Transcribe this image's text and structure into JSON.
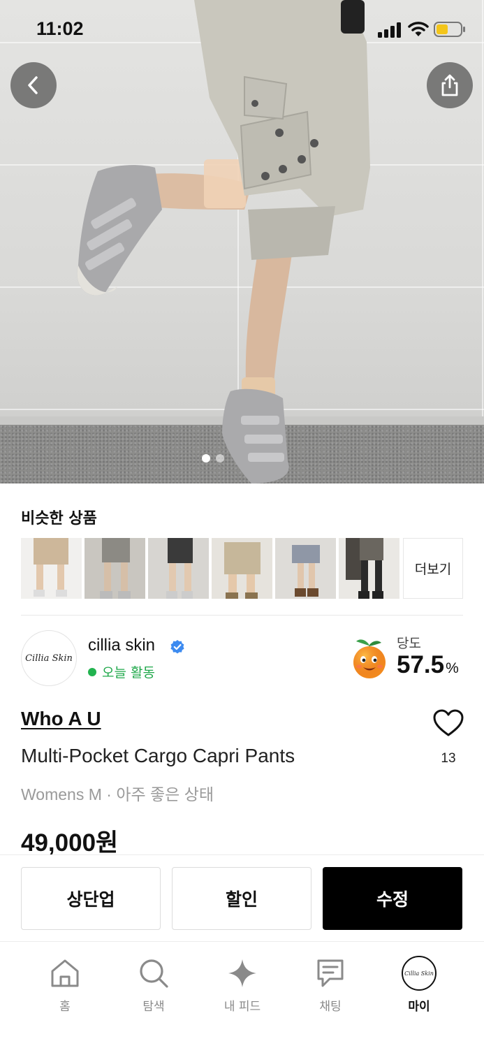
{
  "status_bar": {
    "time": "11:02"
  },
  "similar": {
    "title": "비슷한 상품",
    "more_label": "더보기",
    "thumbnails": [
      "thumb-1",
      "thumb-2",
      "thumb-3",
      "thumb-4",
      "thumb-5",
      "thumb-6"
    ]
  },
  "seller": {
    "avatar_text": "Cillia Skin",
    "name": "cillia skin",
    "activity": "오늘 활동",
    "temperature_label": "당도",
    "temperature_value": "57.5",
    "temperature_unit": "%"
  },
  "product": {
    "brand": "Who A U",
    "title": "Multi-Pocket Cargo Capri Pants",
    "meta": "Womens M · 아주 좋은 상태",
    "price": "49,000원",
    "like_count": "13"
  },
  "actions": {
    "bump": "상단업",
    "discount": "할인",
    "edit": "수정"
  },
  "tabs": [
    {
      "label": "홈",
      "icon": "home-icon"
    },
    {
      "label": "탐색",
      "icon": "search-icon"
    },
    {
      "label": "내 피드",
      "icon": "sparkle-icon"
    },
    {
      "label": "채팅",
      "icon": "chat-icon"
    },
    {
      "label": "마이",
      "icon": "profile-avatar"
    }
  ],
  "colors": {
    "active_green": "#22b34f",
    "verified_blue": "#3d8bf0",
    "primary": "#000000"
  }
}
